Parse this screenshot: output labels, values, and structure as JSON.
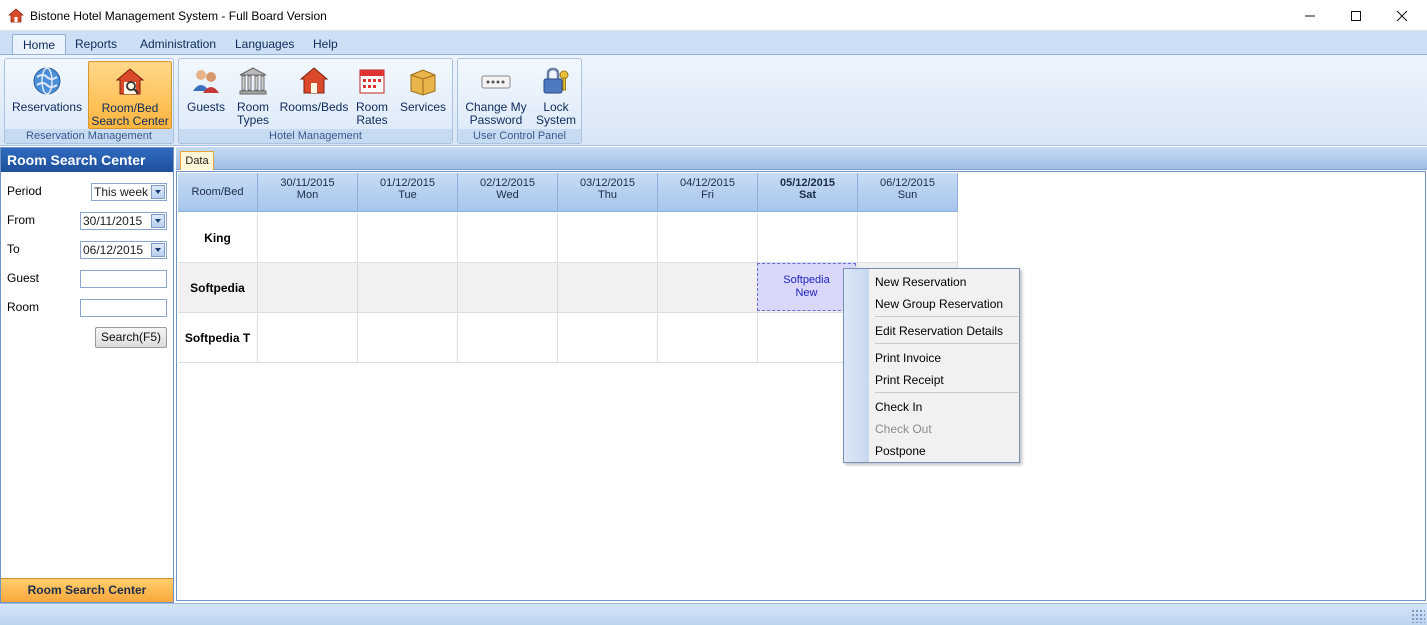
{
  "window": {
    "title": "Bistone Hotel Management System - Full Board Version"
  },
  "menu": {
    "tabs": [
      {
        "label": "Home"
      },
      {
        "label": "Reports"
      },
      {
        "label": "Administration"
      },
      {
        "label": "Languages"
      },
      {
        "label": "Help"
      }
    ]
  },
  "ribbon": {
    "groups": [
      {
        "label": "Reservation Management",
        "buttons": [
          {
            "label": "Reservations"
          },
          {
            "label": "Room/Bed Search Center"
          }
        ]
      },
      {
        "label": "Hotel Management",
        "buttons": [
          {
            "label": "Guests"
          },
          {
            "label": "Room Types"
          },
          {
            "label": "Rooms/Beds"
          },
          {
            "label": "Room Rates"
          },
          {
            "label": "Services"
          }
        ]
      },
      {
        "label": "User Control Panel",
        "buttons": [
          {
            "label": "Change My Password"
          },
          {
            "label": "Lock System"
          }
        ]
      }
    ]
  },
  "left_panel": {
    "title": "Room Search Center",
    "period_label": "Period",
    "period_value": "This week",
    "from_label": "From",
    "from_value": "30/11/2015",
    "to_label": "To",
    "to_value": "06/12/2015",
    "guest_label": "Guest",
    "guest_value": "",
    "room_label": "Room",
    "room_value": "",
    "search_button": "Search(F5)",
    "footer": "Room Search Center"
  },
  "data_tab": "Data",
  "grid": {
    "corner": "Room/Bed",
    "columns": [
      {
        "date": "30/11/2015",
        "day": "Mon"
      },
      {
        "date": "01/12/2015",
        "day": "Tue"
      },
      {
        "date": "02/12/2015",
        "day": "Wed"
      },
      {
        "date": "03/12/2015",
        "day": "Thu"
      },
      {
        "date": "04/12/2015",
        "day": "Fri"
      },
      {
        "date": "05/12/2015",
        "day": "Sat"
      },
      {
        "date": "06/12/2015",
        "day": "Sun"
      }
    ],
    "rows": [
      {
        "name": "King"
      },
      {
        "name": "Softpedia"
      },
      {
        "name": "Softpedia T"
      }
    ],
    "reservation": {
      "guest": "Softpedia",
      "status": "New"
    }
  },
  "context_menu": {
    "items": [
      {
        "label": "New Reservation"
      },
      {
        "label": "New Group Reservation"
      },
      {
        "label": "Edit Reservation Details"
      },
      {
        "label": "Print Invoice"
      },
      {
        "label": "Print Receipt"
      },
      {
        "label": "Check In"
      },
      {
        "label": "Check Out"
      },
      {
        "label": "Postpone"
      }
    ]
  },
  "colors": {
    "accent_orange": "#ffb53e",
    "header_blue": "#1e4f9a",
    "ribbon_blue": "#d8e6f7"
  }
}
